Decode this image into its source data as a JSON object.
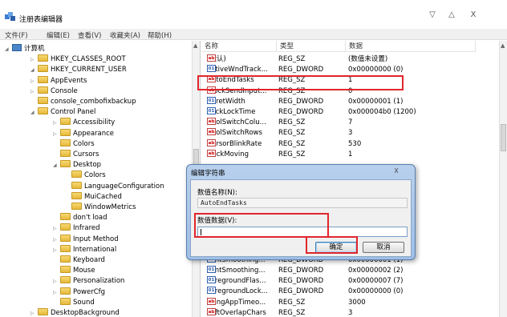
{
  "window": {
    "title": "注册表编辑器",
    "controls": {
      "minimize": "▽",
      "maximize": "△",
      "close": "X"
    }
  },
  "menu": [
    "文件(F)",
    "编辑(E)",
    "查看(V)",
    "收藏夹(A)",
    "帮助(H)"
  ],
  "tree": [
    {
      "label": "计算机",
      "expander": "◢",
      "icon": "computer-icon",
      "indent": 0
    },
    {
      "label": "HKEY_CLASSES_ROOT",
      "expander": "▷",
      "icon": "folder-icon",
      "indent": 1
    },
    {
      "label": "HKEY_CURRENT_USER",
      "expander": "◢",
      "icon": "folder-icon",
      "indent": 1
    },
    {
      "label": "AppEvents",
      "expander": "▷",
      "icon": "folder-icon",
      "indent": 2
    },
    {
      "label": "Console",
      "expander": "▷",
      "icon": "folder-icon",
      "indent": 2
    },
    {
      "label": "console_combofixbackup",
      "expander": "",
      "icon": "folder-icon",
      "indent": 2
    },
    {
      "label": "Control Panel",
      "expander": "◢",
      "icon": "folder-icon",
      "indent": 2
    },
    {
      "label": "Accessibility",
      "expander": "▷",
      "icon": "folder-icon",
      "indent": 3
    },
    {
      "label": "Appearance",
      "expander": "▷",
      "icon": "folder-icon",
      "indent": 3
    },
    {
      "label": "Colors",
      "expander": "",
      "icon": "folder-icon",
      "indent": 3
    },
    {
      "label": "Cursors",
      "expander": "",
      "icon": "folder-icon",
      "indent": 3
    },
    {
      "label": "Desktop",
      "expander": "◢",
      "icon": "folder-icon",
      "indent": 3
    },
    {
      "label": "Colors",
      "expander": "",
      "icon": "folder-icon",
      "indent": 4
    },
    {
      "label": "LanguageConfiguration",
      "expander": "",
      "icon": "folder-icon",
      "indent": 4
    },
    {
      "label": "MuiCached",
      "expander": "",
      "icon": "folder-icon",
      "indent": 4
    },
    {
      "label": "WindowMetrics",
      "expander": "",
      "icon": "folder-icon",
      "indent": 4
    },
    {
      "label": "don't load",
      "expander": "",
      "icon": "folder-icon",
      "indent": 3
    },
    {
      "label": "Infrared",
      "expander": "▷",
      "icon": "folder-icon",
      "indent": 3
    },
    {
      "label": "Input Method",
      "expander": "▷",
      "icon": "folder-icon",
      "indent": 3
    },
    {
      "label": "International",
      "expander": "▷",
      "icon": "folder-icon",
      "indent": 3
    },
    {
      "label": "Keyboard",
      "expander": "",
      "icon": "folder-icon",
      "indent": 3
    },
    {
      "label": "Mouse",
      "expander": "",
      "icon": "folder-icon",
      "indent": 3
    },
    {
      "label": "Personalization",
      "expander": "▷",
      "icon": "folder-icon",
      "indent": 3
    },
    {
      "label": "PowerCfg",
      "expander": "▷",
      "icon": "folder-icon",
      "indent": 3
    },
    {
      "label": "Sound",
      "expander": "",
      "icon": "folder-icon",
      "indent": 3
    },
    {
      "label": "DesktopBackground",
      "expander": "▷",
      "icon": "folder-icon",
      "indent": 2
    }
  ],
  "columns": {
    "name": "名称",
    "type": "类型",
    "data": "数据"
  },
  "values": [
    {
      "name": "(默认)",
      "type": "REG_SZ",
      "data": "(数值未设置)",
      "kind": "ab"
    },
    {
      "name": "ActiveWndTrack...",
      "type": "REG_DWORD",
      "data": "0x00000000 (0)",
      "kind": "bin"
    },
    {
      "name": "AutoEndTasks",
      "type": "REG_SZ",
      "data": "1",
      "kind": "ab"
    },
    {
      "name": "BlockSendInput...",
      "type": "REG_SZ",
      "data": "0",
      "kind": "ab"
    },
    {
      "name": "CaretWidth",
      "type": "REG_DWORD",
      "data": "0x00000001 (1)",
      "kind": "bin"
    },
    {
      "name": "ClickLockTime",
      "type": "REG_DWORD",
      "data": "0x000004b0 (1200)",
      "kind": "bin"
    },
    {
      "name": "CoolSwitchColu...",
      "type": "REG_SZ",
      "data": "7",
      "kind": "ab"
    },
    {
      "name": "CoolSwitchRows",
      "type": "REG_SZ",
      "data": "3",
      "kind": "ab"
    },
    {
      "name": "CursorBlinkRate",
      "type": "REG_SZ",
      "data": "530",
      "kind": "ab"
    },
    {
      "name": "DockMoving",
      "type": "REG_SZ",
      "data": "1",
      "kind": "ab"
    },
    {
      "name": "",
      "type": "",
      "data": "",
      "kind": "bin"
    },
    {
      "name": "",
      "type": "",
      "data": "",
      "kind": "ab"
    },
    {
      "name": "",
      "type": "",
      "data": "",
      "kind": "ab"
    },
    {
      "name": "",
      "type": "",
      "data": "",
      "kind": "ab"
    },
    {
      "name": "",
      "type": "",
      "data": "",
      "kind": "ab"
    },
    {
      "name": "",
      "type": "",
      "data": "",
      "kind": "ab"
    },
    {
      "name": "",
      "type": "",
      "data": "",
      "kind": "ab"
    },
    {
      "name": "",
      "type": "",
      "data": "",
      "kind": "ab"
    },
    {
      "name": "",
      "type": "",
      "data": "",
      "kind": "ab"
    },
    {
      "name": "FontSmoothing...",
      "type": "REG_DWORD",
      "data": "0x00000001 (1)",
      "kind": "bin"
    },
    {
      "name": "FontSmoothing...",
      "type": "REG_DWORD",
      "data": "0x00000002 (2)",
      "kind": "bin"
    },
    {
      "name": "ForegroundFlas...",
      "type": "REG_DWORD",
      "data": "0x00000007 (7)",
      "kind": "bin"
    },
    {
      "name": "ForegroundLock...",
      "type": "REG_DWORD",
      "data": "0x00000000 (0)",
      "kind": "bin"
    },
    {
      "name": "HungAppTimeo...",
      "type": "REG_SZ",
      "data": "3000",
      "kind": "ab"
    },
    {
      "name": "LeftOverlapChars",
      "type": "REG_SZ",
      "data": "3",
      "kind": "ab"
    }
  ],
  "dialog": {
    "title": "编辑字符串",
    "close": "X",
    "name_label": "数值名称(N):",
    "name_value": "AutoEndTasks",
    "data_label": "数值数据(V):",
    "data_value": "",
    "ok": "确定",
    "cancel": "取消"
  },
  "colors": {
    "highlight": "#e0262c",
    "dialog_frame": "#9fbfe6"
  }
}
